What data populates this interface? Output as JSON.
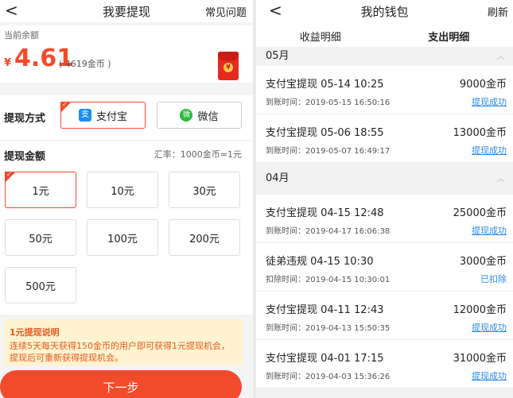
{
  "left": {
    "header": {
      "back": "<",
      "title": "我要提现",
      "faq": "常见问题"
    },
    "balance": {
      "label": "当前余额",
      "currency": "¥",
      "amount": "4.61",
      "coins": "( 4619金币 )"
    },
    "redpacket_symbol": "¥",
    "method": {
      "label": "提现方式",
      "options": [
        {
          "label": "支付宝",
          "icon": "alipay-icon",
          "icon_glyph": "支",
          "selected": true
        },
        {
          "label": "微信",
          "icon": "wechat-icon",
          "icon_glyph": "微",
          "selected": false
        }
      ]
    },
    "amount": {
      "label": "提现金额",
      "rate": "汇率：1000金币=1元",
      "options": [
        "1元",
        "10元",
        "30元",
        "50元",
        "100元",
        "200元",
        "500元"
      ],
      "selected_index": 0
    },
    "notice": {
      "title": "1元提现说明",
      "text": "连续5天每天获得150金币的用户即可获得1元提现机会，提现后可重新获得提现机会。"
    },
    "next_button": "下一步",
    "accent_color": "#f24b2c"
  },
  "right": {
    "header": {
      "back": "<",
      "title": "我的钱包",
      "refresh": "刷新"
    },
    "tabs": [
      {
        "label": "收益明细",
        "active": false
      },
      {
        "label": "支出明细",
        "active": true
      }
    ],
    "months": [
      {
        "label": "05月",
        "records": [
          {
            "title": "支付宝提现  05-14 10:25",
            "amount": "9000金币",
            "sub": "到账时间：2019-05-15 16:50:16",
            "status": "提现成功"
          },
          {
            "title": "支付宝提现  05-06 18:55",
            "amount": "13000金币",
            "sub": "到账时间：2019-05-07 16:49:17",
            "status": "提现成功"
          }
        ]
      },
      {
        "label": "04月",
        "records": [
          {
            "title": "支付宝提现  04-15 12:48",
            "amount": "25000金币",
            "sub": "到账时间：2019-04-17 16:06:38",
            "status": "提现成功"
          },
          {
            "title": "徒弟违规  04-15 10:30",
            "amount": "3000金币",
            "sub": "扣除时间：2019-04-15 10:30:01",
            "status": "已扣除"
          },
          {
            "title": "支付宝提现  04-11 12:43",
            "amount": "12000金币",
            "sub": "到账时间：2019-04-13 15:50:35",
            "status": "提现成功"
          },
          {
            "title": "支付宝提现  04-01 17:15",
            "amount": "31000金币",
            "sub": "到账时间：2019-04-03 15:36:26",
            "status": "提现成功"
          }
        ]
      }
    ],
    "status_color": "#2a8ae6"
  }
}
